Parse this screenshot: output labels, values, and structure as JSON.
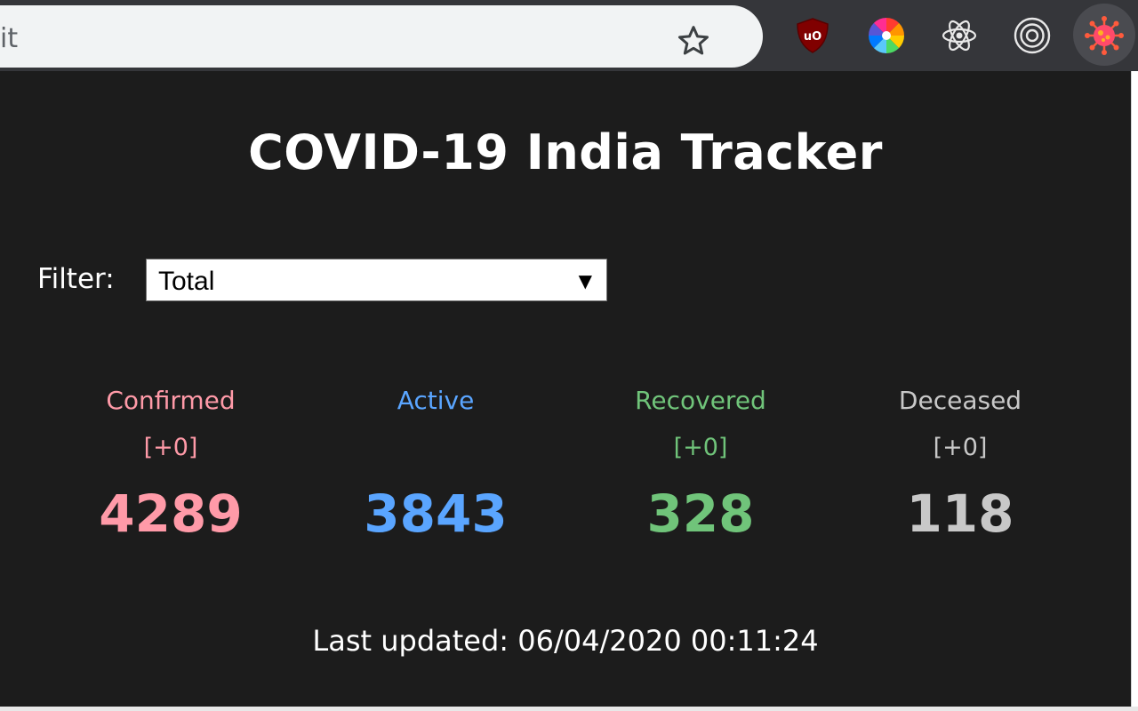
{
  "browser": {
    "omnibox_text": "it",
    "extensions": [
      {
        "icon": "ublock-origin-icon",
        "label": "uO"
      },
      {
        "icon": "color-wheel-icon"
      },
      {
        "icon": "react-devtools-icon"
      },
      {
        "icon": "target-rings-icon"
      },
      {
        "icon": "covid-virus-icon"
      }
    ]
  },
  "app": {
    "title": "COVID-19 India Tracker",
    "filter": {
      "label": "Filter:",
      "selected": "Total"
    },
    "stats": [
      {
        "label": "Confirmed",
        "delta": "[+0]",
        "value": "4289",
        "color": "#ff9aa8"
      },
      {
        "label": "Active",
        "delta": "",
        "value": "3843",
        "color": "#5aa5ff"
      },
      {
        "label": "Recovered",
        "delta": "[+0]",
        "value": "328",
        "color": "#70c47a"
      },
      {
        "label": "Deceased",
        "delta": "[+0]",
        "value": "118",
        "color": "#c8c8c8"
      }
    ],
    "last_updated": "Last updated: 06/04/2020 00:11:24"
  }
}
